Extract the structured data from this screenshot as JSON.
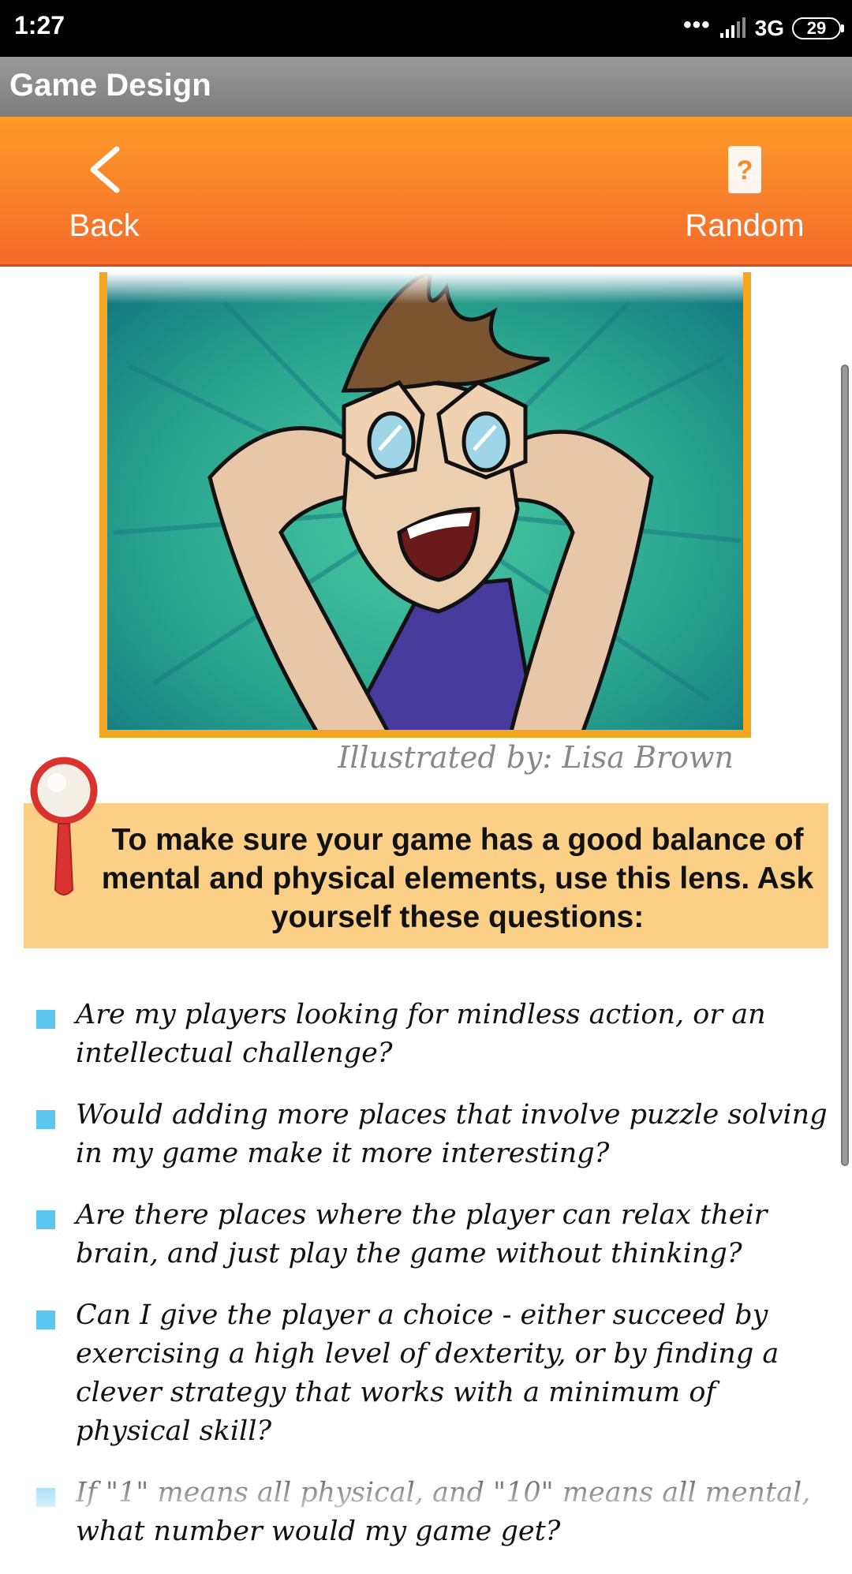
{
  "status_bar": {
    "time": "1:27",
    "signal_dots": "•••",
    "network": "3G",
    "battery": "29"
  },
  "app_bar": {
    "title": "Game Design"
  },
  "toolbar": {
    "back_label": "Back",
    "random_label": "Random",
    "back_icon": "chevron-left-icon",
    "random_icon": "question-card-icon"
  },
  "content": {
    "illustration_alt": "",
    "credit": "Illustrated by: Lisa Brown",
    "lens_intro": "To make sure your game has a good balance of mental and physical elements, use this lens. Ask yourself these questions:",
    "questions": [
      "Are my players looking for mindless action, or an intellectual challenge?",
      "Would adding more places that involve puzzle solving in my game make it more interesting?",
      "Are there places where the player can relax their brain, and just play the game without thinking?",
      "Can I give the player a choice - either succeed by exercising a high level of dexterity, or by finding a clever strategy that works with a minimum of physical skill?",
      "If \"1\" means all physical, and \"10\" means all mental, what number would my game get?"
    ]
  },
  "colors": {
    "toolbar_top": "#fd9b28",
    "toolbar_bottom": "#f56a2b",
    "lens_box": "#fbcf86",
    "bullet": "#5bc6f0",
    "frame": "#f5a623"
  }
}
